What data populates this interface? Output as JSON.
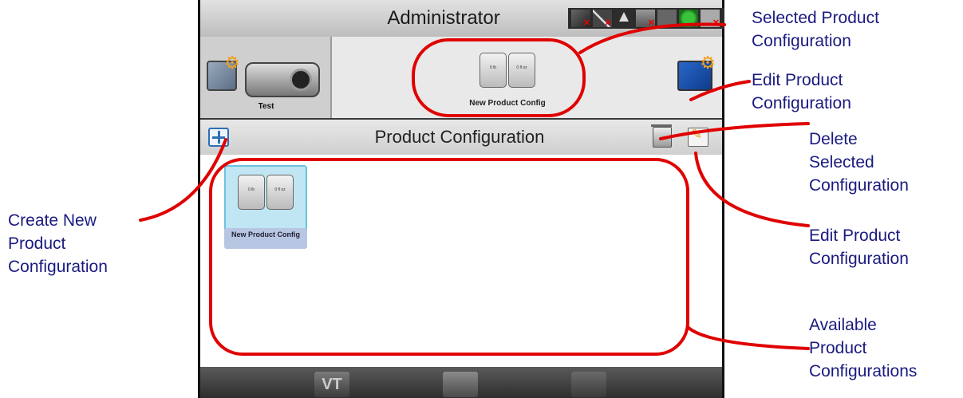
{
  "screen": {
    "title": "Administrator",
    "machine_tile_label": "Test",
    "selected_config": {
      "label": "New Product Config",
      "card1": "0 lb",
      "card2": "0 fl oz"
    },
    "header_title": "Product Configuration",
    "list_items": [
      {
        "label": "New Product Config",
        "card1": "0 lb",
        "card2": "0 fl oz"
      }
    ],
    "nav": {
      "vt_label": "VT"
    }
  },
  "annotations": {
    "selected_config": [
      "Selected Product",
      "Configuration"
    ],
    "edit_top": [
      "Edit Product",
      "Configuration"
    ],
    "delete": [
      "Delete",
      "Selected",
      "Configuration"
    ],
    "edit_bar": [
      "Edit Product",
      "Configuration"
    ],
    "create_new": [
      "Create New",
      "Product",
      "Configuration"
    ],
    "available": [
      "Available",
      "Product",
      "Configurations"
    ]
  },
  "colors": {
    "annotation_text": "#1a1a80",
    "callout": "#e00000",
    "selection_tile": "#bfe6f2"
  }
}
